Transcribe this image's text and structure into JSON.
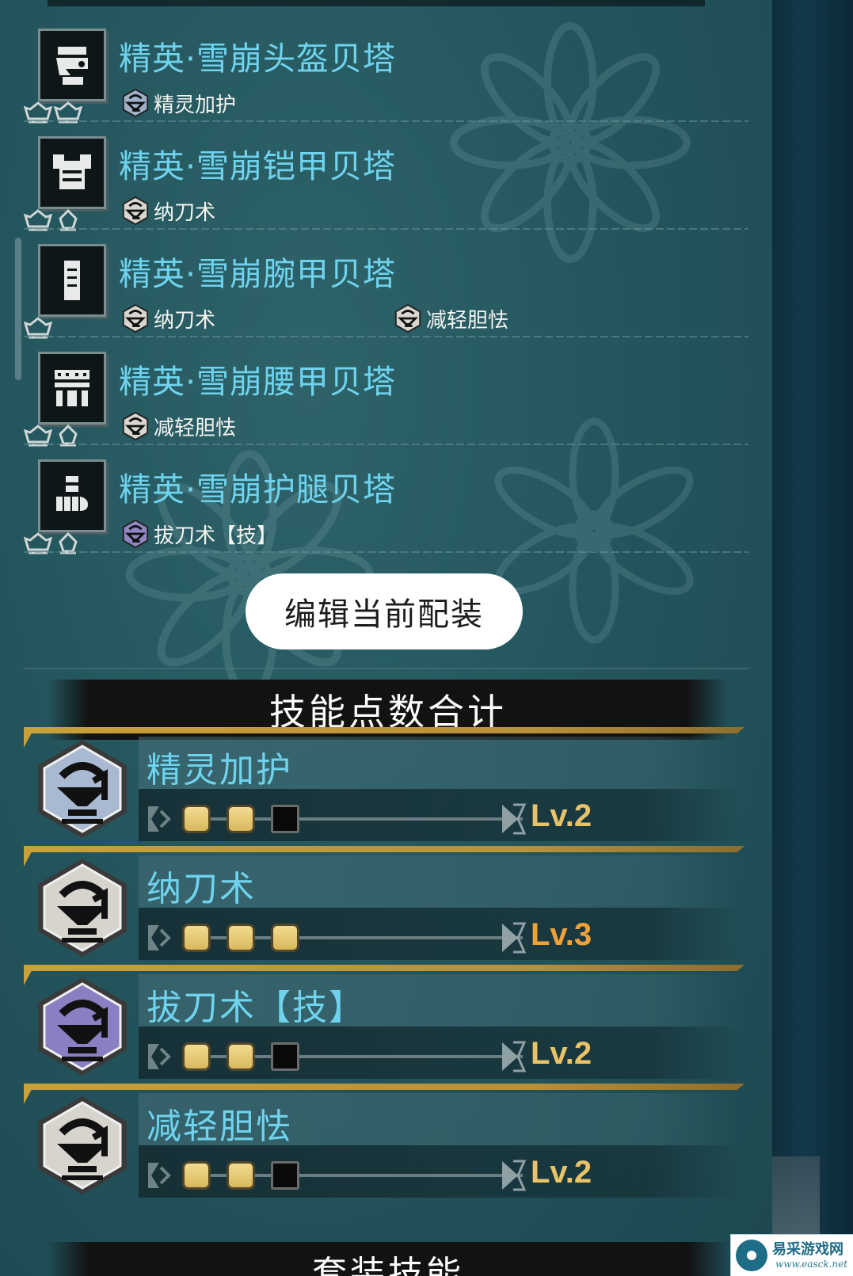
{
  "equipment": [
    {
      "name": "精英·雪崩头盔贝塔",
      "icon": "helmet-icon",
      "slots": [
        "jewel-slot",
        "jewel-slot"
      ],
      "skills": [
        "精灵加护"
      ],
      "skill_colors": [
        "#9fb0c8"
      ]
    },
    {
      "name": "精英·雪崩铠甲贝塔",
      "icon": "chest-armor-icon",
      "slots": [
        "jewel-slot",
        "small-jewel-slot"
      ],
      "skills": [
        "纳刀术"
      ],
      "skill_colors": [
        "#d8d6cf"
      ]
    },
    {
      "name": "精英·雪崩腕甲贝塔",
      "icon": "arm-armor-icon",
      "slots": [
        "jewel-slot"
      ],
      "skills": [
        "纳刀术",
        "减轻胆怯"
      ],
      "skill_colors": [
        "#d8d6cf",
        "#d8d6cf"
      ]
    },
    {
      "name": "精英·雪崩腰甲贝塔",
      "icon": "waist-armor-icon",
      "slots": [
        "jewel-slot",
        "small-jewel-slot"
      ],
      "skills": [
        "减轻胆怯"
      ],
      "skill_colors": [
        "#d8d6cf"
      ]
    },
    {
      "name": "精英·雪崩护腿贝塔",
      "icon": "leg-armor-icon",
      "slots": [
        "jewel-slot",
        "small-jewel-slot"
      ],
      "skills": [
        "拔刀术【技】"
      ],
      "skill_colors": [
        "#8f86c4"
      ]
    }
  ],
  "edit_button": "编辑当前配装",
  "skill_total_header": "技能点数合计",
  "skill_totals": [
    {
      "name": "精灵加护",
      "level": 2,
      "max_level": 3,
      "level_text": "Lv.2",
      "hex_color": "#a9b9d2",
      "is_max": false
    },
    {
      "name": "纳刀术",
      "level": 3,
      "max_level": 3,
      "level_text": "Lv.3",
      "hex_color": "#d6d4cc",
      "is_max": true
    },
    {
      "name": "拔刀术【技】",
      "level": 2,
      "max_level": 3,
      "level_text": "Lv.2",
      "hex_color": "#8a7fc2",
      "is_max": false
    },
    {
      "name": "减轻胆怯",
      "level": 2,
      "max_level": 3,
      "level_text": "Lv.2",
      "hex_color": "#d6d4cc",
      "is_max": false
    }
  ],
  "set_skill_header": "套装技能",
  "watermark": {
    "name": "易采游戏网",
    "url": "www.easck.net"
  },
  "colors": {
    "name_cyan": "#6fd3ee",
    "level_gold": "#e8c36a",
    "level_max": "#f0a13a",
    "accent_gold": "#c8a13a"
  }
}
